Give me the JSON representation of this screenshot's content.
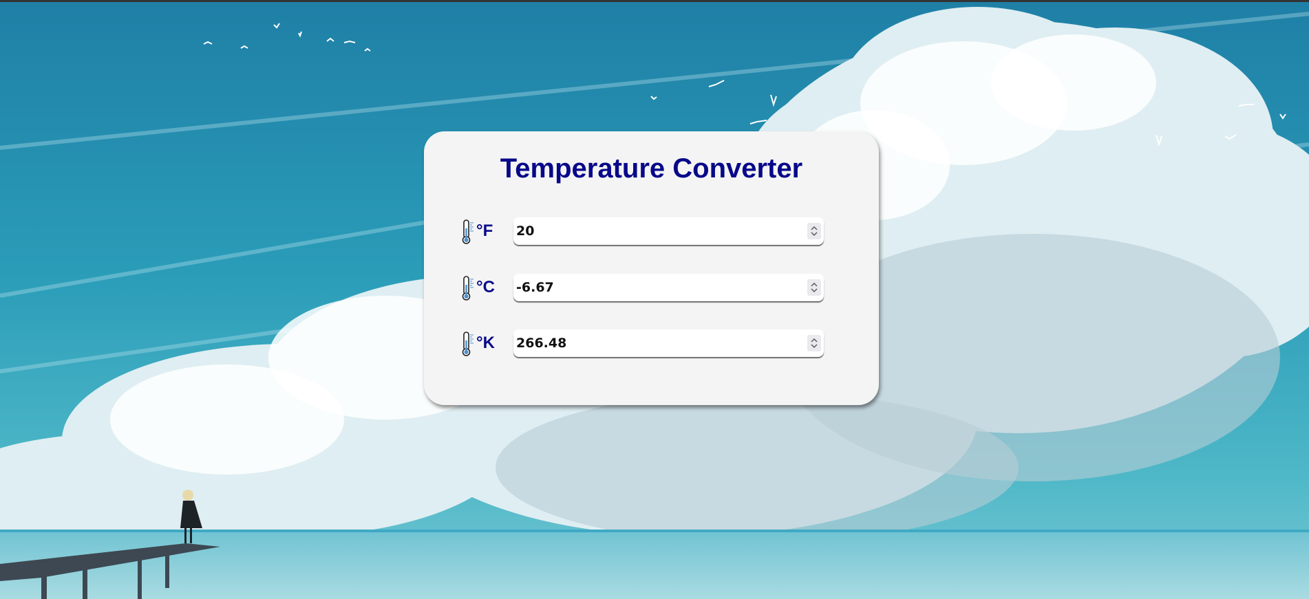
{
  "app": {
    "title": "Temperature Converter"
  },
  "converter": {
    "fields": [
      {
        "unit": "°F",
        "value": "20",
        "icon": "thermometer-icon"
      },
      {
        "unit": "°C",
        "value": "-6.67",
        "icon": "thermometer-icon"
      },
      {
        "unit": "°K",
        "value": "266.48",
        "icon": "thermometer-icon"
      }
    ]
  },
  "colors": {
    "title": "#08088a",
    "card_background": "#f4f4f4",
    "sky": "#2a9cb6"
  }
}
